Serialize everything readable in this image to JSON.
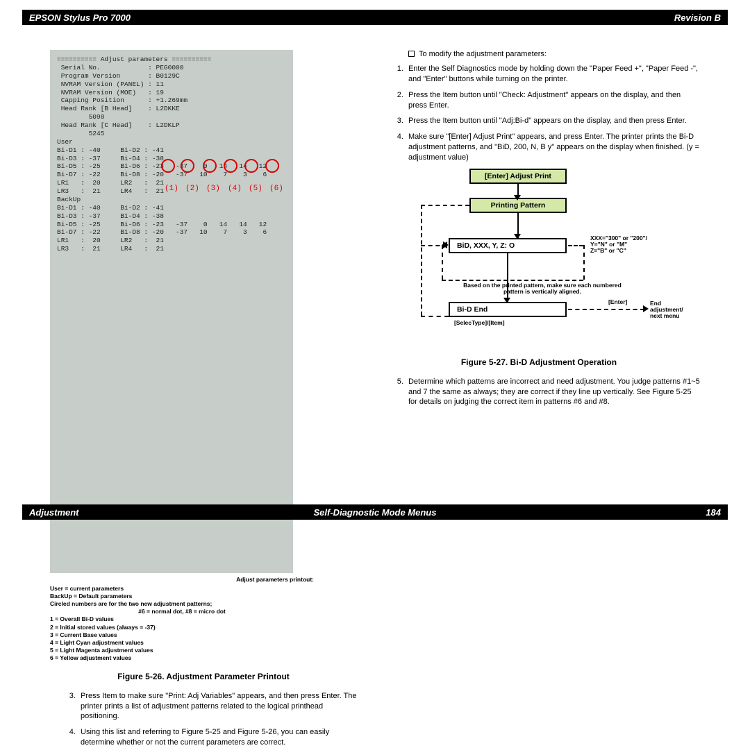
{
  "header": {
    "left": "EPSON Stylus Pro 7000",
    "right": "Revision B"
  },
  "footer": {
    "left": "Adjustment",
    "mid": "Self-Diagnostic Mode Menus",
    "right": "184"
  },
  "left": {
    "printout_lines": [
      "========== Adjust parameters ==========",
      " Serial No.            : PEG0000",
      " Program Version       : B0129C",
      " NVRAM Version (PANEL) : 11",
      " NVRAM Version (MOE)   : 19",
      " Capping Position      : +1.269mm",
      " Head Rank [B Head]    : L2DKKE",
      "        5098",
      " Head Rank [C Head]    : L2DKLP",
      "        5245",
      "User",
      "Bi-D1 : -40     Bi-D2 : -41",
      "Bi-D3 : -37     Bi-D4 : -38",
      "Bi-D5 : -25     Bi-D6 : -23   -37    0   14   14   12",
      "Bi-D7 : -22     Bi-D8 : -20   -37   10    7    3    6",
      "LR1   :  20     LR2   :  21",
      "LR3   :  21     LR4   :  21",
      "BackUp",
      "Bi-D1 : -40     Bi-D2 : -41",
      "Bi-D3 : -37     Bi-D4 : -38",
      "Bi-D5 : -25     Bi-D6 : -23   -37    0   14   14   12",
      "Bi-D7 : -22     Bi-D8 : -20   -37   10    7    3    6",
      "LR1   :  20     LR2   :  21",
      "LR3   :  21     LR4   :  21"
    ],
    "red_labels": [
      "(1)",
      "(2)",
      "(3)",
      "(4)",
      "(5)",
      "(6)"
    ],
    "legend_caption": "Adjust parameters printout:",
    "legend": [
      "User = current parameters",
      "BackUp = Default parameters",
      "Circled numbers are for the two new adjustment patterns;",
      "#6 = normal dot, #8 = micro dot",
      "1 = Overall Bi-D values",
      "2 = Initial stored values (always = -37)",
      "3 = Current Base values",
      "4 = Light Cyan adjustment values",
      "5 = Light Magenta adjustment values",
      "6 = Yellow adjustment values"
    ],
    "fig_caption": "Figure 5-26.  Adjustment Parameter Printout",
    "steps": [
      "Press Item to make sure \"Print: Adj Variables\" appears, and then press Enter. The printer prints a list of adjustment patterns related to the logical printhead positioning.",
      "Using this list and referring to Figure 5-25 and Figure 5-26, you can easily determine whether or not the current parameters are correct."
    ]
  },
  "right": {
    "intro": "To modify the adjustment parameters:",
    "steps": [
      "Enter the Self Diagnostics mode by holding down the \"Paper Feed +\", \"Paper Feed -\", and \"Enter\" buttons while turning on the printer.",
      "Press the Item button until \"Check: Adjustment\" appears on the display, and then press Enter.",
      "Press the Item button until \"Adj:Bi-d\" appears on the display, and then press Enter.",
      "Make sure \"[Enter] Adjust Print\" appears, and press Enter. The printer prints the Bi-D adjustment patterns, and \"BiD, 200, N, B   y\" appears on the display when finished. (y = adjustment value)"
    ],
    "flow": {
      "b1": "[Enter] Adjust Print",
      "b2": "Printing Pattern",
      "b3": "BiD, XXX, Y, Z:     O",
      "b4": "Bi-D End",
      "note1a": "XXX=\"300\" or \"200\"/",
      "note1b": "Y=\"N\" or \"M\"",
      "note1c": "Z=\"B\" or \"C\"",
      "note2": "Based on the printed pattern, make sure each numbered pattern is vertically aligned.",
      "lab_enter": "[Enter]",
      "lab_end": "End adjustment/ next menu",
      "lab_sel": "[SelecType]/[Item]"
    },
    "fig_caption": "Figure 5-27.  Bi-D Adjustment Operation",
    "step5": "Determine which patterns are incorrect and need adjustment. You judge patterns #1~5 and 7 the same as always; they are correct if they line up vertically. See Figure 5-25 for details on judging the correct item in patterns #6 and #8."
  }
}
